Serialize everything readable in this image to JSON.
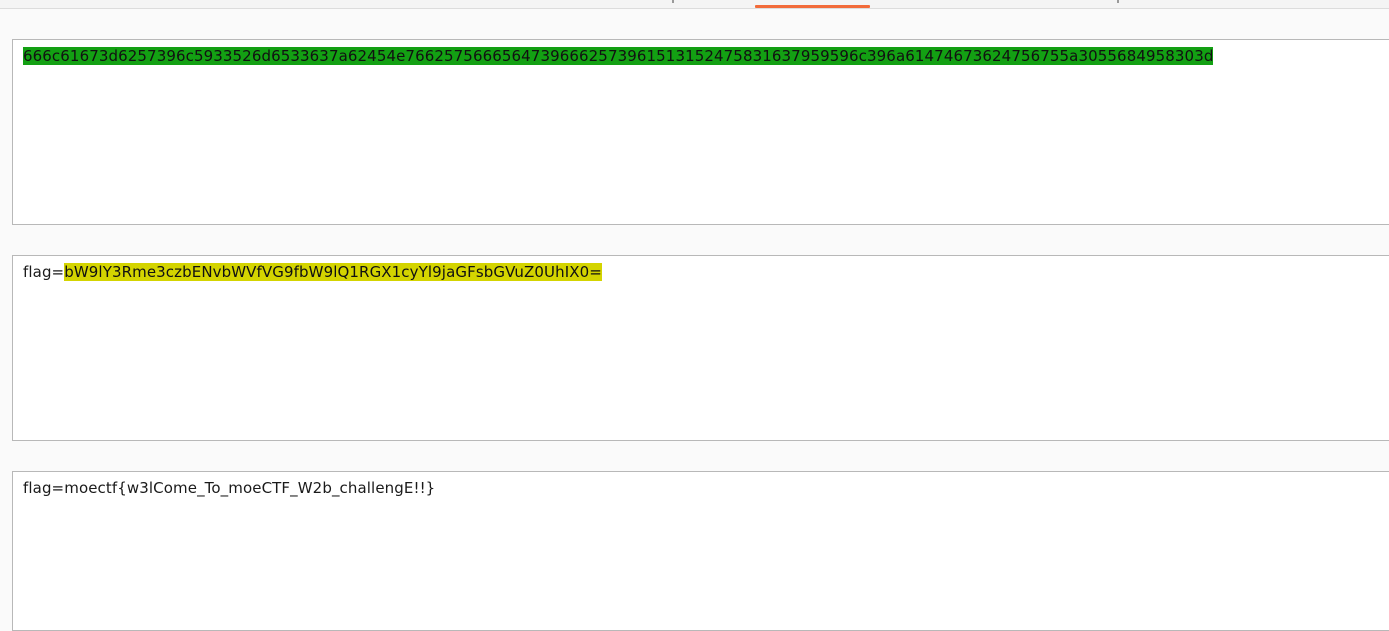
{
  "colors": {
    "accent_underline": "#f26b3a",
    "highlight_green": "#13a013",
    "highlight_yellow": "#d4d400",
    "panel_border": "#b8b8b8",
    "panel_background": "#ffffff"
  },
  "panels": [
    {
      "prefix": "",
      "highlighted": "666c61673d6257396c5933526d6533637a62454e76625756665647396662573961513152475831637959596c396a61474673624756755a3055684958303d",
      "highlight": "green"
    },
    {
      "prefix": "flag=",
      "highlighted": "bW9lY3Rme3czbENvbWVfVG9fbW9lQ1RGX1cyYl9jaGFsbGVuZ0UhIX0=",
      "highlight": "yellow"
    },
    {
      "prefix": "flag=moectf{w3lCome_To_moeCTF_W2b_challengE!!}",
      "highlighted": "",
      "highlight": "none"
    }
  ]
}
